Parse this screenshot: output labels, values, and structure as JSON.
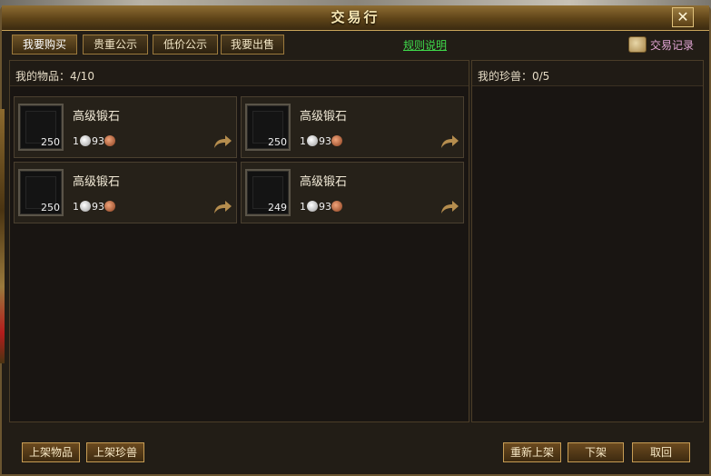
{
  "window": {
    "title": "交易行",
    "close_label": "✕"
  },
  "tabs": [
    {
      "label": "我要购买"
    },
    {
      "label": "贵重公示"
    },
    {
      "label": "低价公示"
    },
    {
      "label": "我要出售"
    }
  ],
  "rules_link": "规则说明",
  "trade_log": {
    "label": "交易记录",
    "icon": "scroll-icon"
  },
  "items_panel": {
    "title": "我的物品：4/10"
  },
  "pets_panel": {
    "title": "我的珍兽：0/5"
  },
  "items": [
    {
      "name": "高级锻石",
      "qty": "250",
      "gold": "1",
      "silver": "93"
    },
    {
      "name": "高级锻石",
      "qty": "250",
      "gold": "1",
      "silver": "93"
    },
    {
      "name": "高级锻石",
      "qty": "250",
      "gold": "1",
      "silver": "93"
    },
    {
      "name": "高级锻石",
      "qty": "249",
      "gold": "1",
      "silver": "93"
    }
  ],
  "buttons": {
    "list_item": "上架物品",
    "list_pet": "上架珍兽",
    "relist": "重新上架",
    "delist": "下架",
    "withdraw": "取回"
  },
  "colors": {
    "accent": "#c79d55",
    "link": "#3fd94b",
    "trade_log": "#e4a7d6"
  }
}
